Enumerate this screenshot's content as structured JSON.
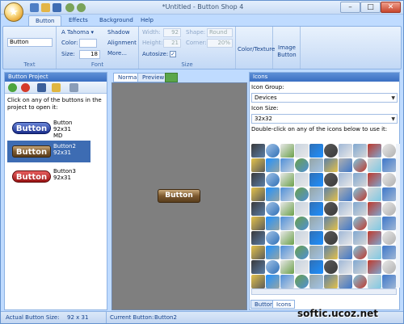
{
  "window": {
    "title": "*Untitled - Button Shop 4"
  },
  "tabs": [
    "Button",
    "Effects",
    "Background",
    "Help"
  ],
  "ribbon": {
    "text": {
      "value": "Button",
      "label": "Text"
    },
    "font": {
      "family": "Tahoma",
      "color_label": "Color:",
      "size_label": "Size:",
      "size": "18",
      "shadow": "Shadow",
      "alignment": "Alignment",
      "more": "More...",
      "label": "Font"
    },
    "size": {
      "width_label": "Width:",
      "width": "92",
      "height_label": "Height:",
      "height": "21",
      "shape_label": "Shape:",
      "shape": "Round",
      "corner_label": "Corner:",
      "corner": "20%",
      "autosize_label": "Autosize:",
      "label": "Size"
    },
    "color_texture": "Color/Texture",
    "image_button": "Image Button"
  },
  "left_panel": {
    "title": "Button Project",
    "hint": "Click on any of the buttons in the project to open it:",
    "items": [
      {
        "preview": "Button",
        "name": "Button",
        "size": "92x31",
        "extra": "MD"
      },
      {
        "preview": "Button",
        "name": "Button2",
        "size": "92x31",
        "extra": ""
      },
      {
        "preview": "Button",
        "name": "Button3",
        "size": "92x31",
        "extra": ""
      }
    ]
  },
  "center": {
    "tabs": [
      "Normal",
      "Preview"
    ],
    "canvas_button": "Button"
  },
  "right_panel": {
    "title": "Icons",
    "group_label": "Icon Group:",
    "group": "Devices",
    "size_label": "Icon Size:",
    "size": "32x32",
    "hint": "Double-click on any of the icons below to use it:",
    "bottom_tabs": [
      "Buttons",
      "Icons"
    ]
  },
  "status": {
    "actual_label": "Actual Button Size:",
    "actual": "92 x 31",
    "current_label": "Current Button:",
    "current": "Button2"
  },
  "watermark": "softic.ucoz.net",
  "colors": {
    "accent": "#15428b",
    "ribbon_bg": "#d3e3f8",
    "selection": "#3d6cb3",
    "canvas": "#7f7f7f"
  }
}
